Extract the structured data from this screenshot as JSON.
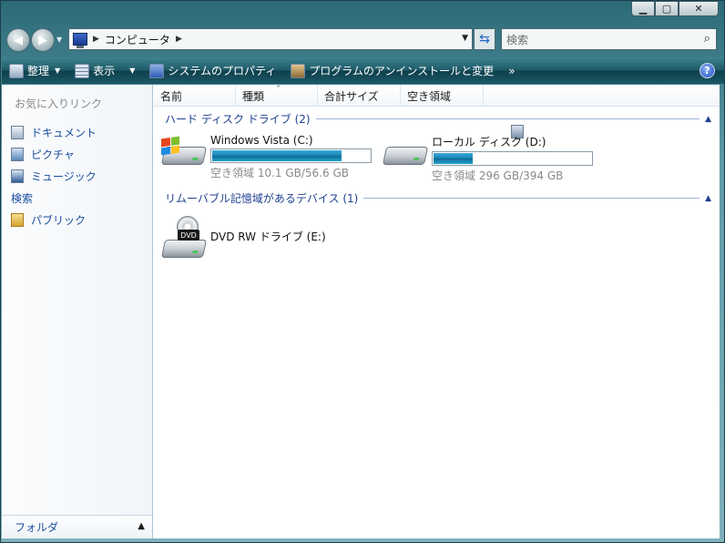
{
  "window": {
    "buttons": {
      "minimize": "▁",
      "maximize": "▢",
      "close": "✕"
    }
  },
  "nav": {
    "back_icon": "back-arrow-icon",
    "forward_icon": "forward-arrow-icon",
    "address": {
      "crumbs": [
        "コンピュータ"
      ]
    },
    "search": {
      "placeholder": "検索"
    }
  },
  "toolbar": {
    "items": [
      {
        "label": "整理",
        "has_menu": true
      },
      {
        "label": "表示",
        "has_menu": true
      },
      {
        "label": "システムのプロパティ"
      },
      {
        "label": "プログラムのアンインストールと変更"
      }
    ],
    "overflow": "»",
    "help": "?"
  },
  "nav_pane": {
    "title": "お気に入りリンク",
    "items": [
      {
        "label": "ドキュメント"
      },
      {
        "label": "ピクチャ"
      },
      {
        "label": "ミュージック"
      },
      {
        "label": "検索"
      },
      {
        "label": "パブリック"
      }
    ],
    "folders_label": "フォルダ"
  },
  "columns": [
    "名前",
    "種類",
    "合計サイズ",
    "空き領域"
  ],
  "groups": [
    {
      "title": "ハード ディスク ドライブ (2)",
      "drives": [
        {
          "name": "Windows Vista (C:)",
          "free_text": "空き領域 10.1 GB/56.6 GB",
          "used_fraction": 0.82,
          "icon": "windows-drive-icon"
        },
        {
          "name": "ローカル ディスク (D:)",
          "free_text": "空き領域 296 GB/394 GB",
          "used_fraction": 0.25,
          "icon": "hard-disk-icon"
        }
      ]
    },
    {
      "title": "リムーバブル記憶域があるデバイス (1)",
      "drives": [
        {
          "name": "DVD RW ドライブ (E:)",
          "label": "DVD",
          "icon": "dvd-drive-icon"
        }
      ]
    }
  ]
}
